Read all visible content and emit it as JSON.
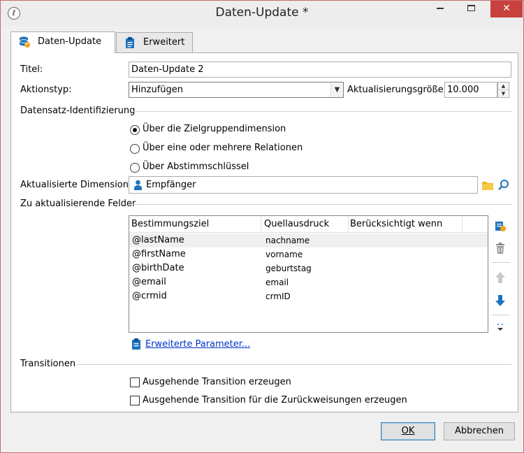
{
  "window": {
    "title": "Daten-Update *"
  },
  "tabs": [
    {
      "label": "Daten-Update"
    },
    {
      "label": "Erweitert"
    }
  ],
  "form": {
    "title_label": "Titel:",
    "title_value": "Daten-Update 2",
    "action_label": "Aktionstyp:",
    "action_value": "Hinzufügen",
    "batch_label": "Aktualisierungsgröße:",
    "batch_value": "10.000"
  },
  "record_id": {
    "heading": "Datensatz-Identifizierung",
    "options": [
      "Über die Zielgruppendimension",
      "Über eine oder mehrere Relationen",
      "Über Abstimmschlüssel"
    ],
    "selected": 0
  },
  "dimension": {
    "label": "Aktualisierte Dimension:",
    "value": "Empfänger"
  },
  "fields": {
    "heading": "Zu aktualisierende Felder",
    "columns": [
      "Bestimmungsziel",
      "Quellausdruck",
      "Berücksichtigt wenn"
    ],
    "rows": [
      {
        "target": "@lastName",
        "source": "nachname"
      },
      {
        "target": "@firstName",
        "source": "vorname"
      },
      {
        "target": "@birthDate",
        "source": "geburtstag"
      },
      {
        "target": "@email",
        "source": "email"
      },
      {
        "target": "@crmid",
        "source": "crmID"
      }
    ],
    "advanced_link": "Erweiterte Parameter..."
  },
  "transitions": {
    "heading": "Transitionen",
    "options": [
      "Ausgehende Transition erzeugen",
      "Ausgehende Transition für die Zurückweisungen erzeugen"
    ]
  },
  "buttons": {
    "ok_label": "OK",
    "cancel_label": "Abbrechen"
  },
  "colors": {
    "close_button": "#c7423d",
    "link": "#0033cc",
    "icon_blue": "#1e73be"
  }
}
